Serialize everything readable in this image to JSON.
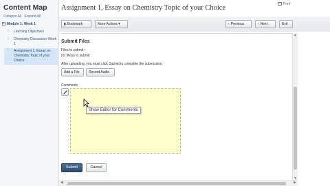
{
  "sidebar": {
    "title": "Content Map",
    "collapse_all": "Collapse All",
    "expand_all": "Expand All",
    "module_label": "Module 1: Week 1",
    "items": [
      {
        "label": "Learning Objectives"
      },
      {
        "label": "Chemistry Discussion Week 1"
      },
      {
        "label": "Assignment 1, Essay on Chemistry Topic of your Choice"
      }
    ]
  },
  "header": {
    "title": "Assignment 1, Essay on Chemistry Topic of your Choice",
    "print_label": "Print"
  },
  "toolbar": {
    "bookmark_label": "Bookmark",
    "more_actions_label": "More Actions",
    "previous_label": "Previous",
    "next_label": "Next",
    "exit_label": "Exit"
  },
  "main": {
    "section_title": "Submit Files",
    "files_label": "Files to submit",
    "files_value": "(0) file(s) to submit",
    "instructions": "After uploading, you must click Submit to complete the submission.",
    "add_file_label": "Add a File",
    "record_audio_label": "Record Audio",
    "comments_label": "Comments",
    "tooltip_text": "Show Editor for Comments",
    "submit_label": "Submit",
    "cancel_label": "Cancel"
  }
}
